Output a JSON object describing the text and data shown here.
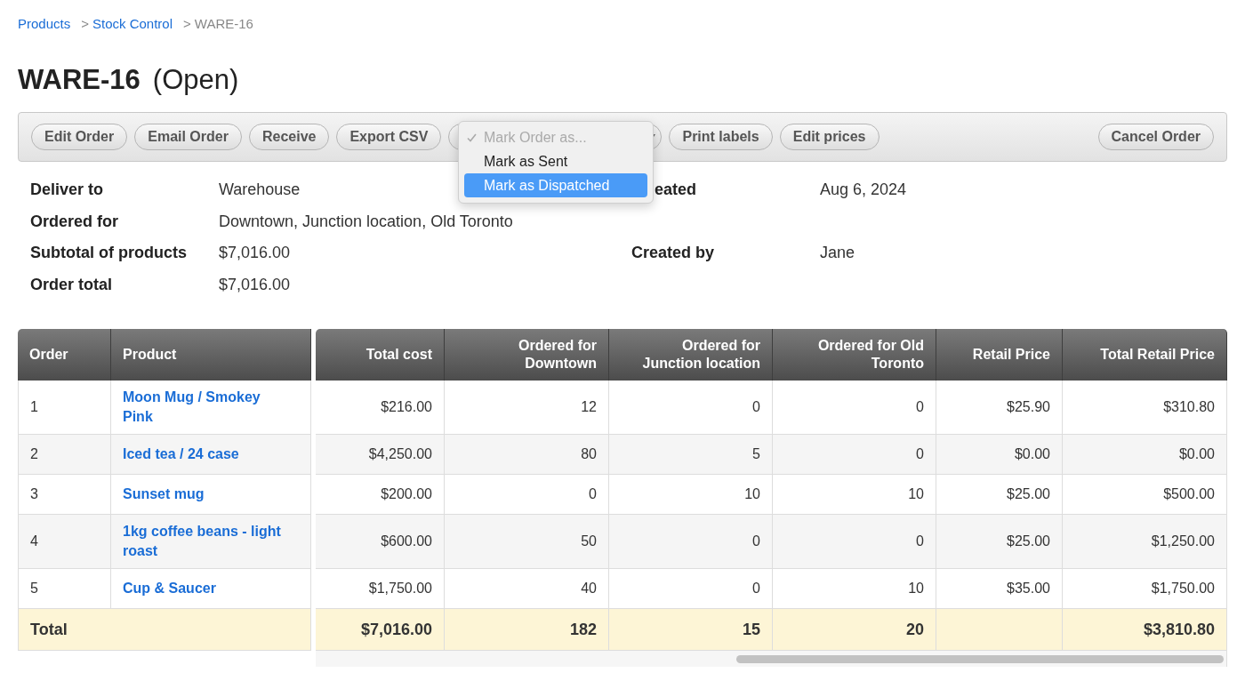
{
  "breadcrumb": [
    {
      "label": "Products",
      "current": false
    },
    {
      "separator": ">",
      "label": "Stock Control",
      "current": false
    },
    {
      "separator": ">",
      "label": "WARE-16",
      "current": true
    }
  ],
  "title": {
    "code": "WARE-16",
    "status": "(Open)"
  },
  "toolbar": {
    "buttons": [
      {
        "label": "Edit Order"
      },
      {
        "label": "Email Order"
      },
      {
        "label": "Receive"
      },
      {
        "label": "Export CSV"
      }
    ],
    "select_menu": [
      {
        "label": "Mark Order as...",
        "checked": true,
        "disabled": true,
        "selected": false
      },
      {
        "label": "Mark as Sent",
        "checked": false,
        "disabled": false,
        "selected": false
      },
      {
        "label": "Mark as Dispatched",
        "checked": false,
        "disabled": false,
        "selected": true
      }
    ],
    "more_buttons": [
      {
        "label": "Print labels"
      },
      {
        "label": "Edit prices"
      }
    ],
    "cancel_button": "Cancel Order"
  },
  "details_left": [
    {
      "label": "Deliver to",
      "value": "Warehouse"
    },
    {
      "label": "Ordered for",
      "value": "Downtown, Junction location, Old Toronto"
    },
    {
      "label": "Subtotal of products",
      "value": "$7,016.00"
    },
    {
      "label": "Order total",
      "value": "$7,016.00"
    }
  ],
  "details_right": [
    {
      "label": "eated",
      "value": "Aug 6, 2024"
    },
    {
      "label": "Created by",
      "value": "Jane"
    }
  ],
  "table": {
    "columns": [
      "Order",
      "Product",
      "Total cost",
      "Ordered for Downtown",
      "Ordered for Junction location",
      "Ordered for Old Toronto",
      "Retail Price",
      "Total Retail Price"
    ],
    "rows": [
      {
        "cells": [
          "1",
          "Moon Mug / Smokey Pink",
          "$216.00",
          "12",
          "0",
          "0",
          "$25.90",
          "$310.80"
        ]
      },
      {
        "cells": [
          "2",
          "Iced tea / 24 case",
          "$4,250.00",
          "80",
          "5",
          "0",
          "$0.00",
          "$0.00"
        ]
      },
      {
        "cells": [
          "3",
          "Sunset mug",
          "$200.00",
          "0",
          "10",
          "10",
          "$25.00",
          "$500.00"
        ]
      },
      {
        "cells": [
          "4",
          "1kg coffee beans - light roast",
          "$600.00",
          "50",
          "0",
          "0",
          "$25.00",
          "$1,250.00"
        ]
      },
      {
        "cells": [
          "5",
          "Cup & Saucer",
          "$1,750.00",
          "40",
          "0",
          "10",
          "$35.00",
          "$1,750.00"
        ]
      }
    ],
    "total": {
      "cells": [
        "Total",
        "",
        "$7,016.00",
        "182",
        "15",
        "20",
        "",
        "$3,810.80"
      ]
    }
  }
}
